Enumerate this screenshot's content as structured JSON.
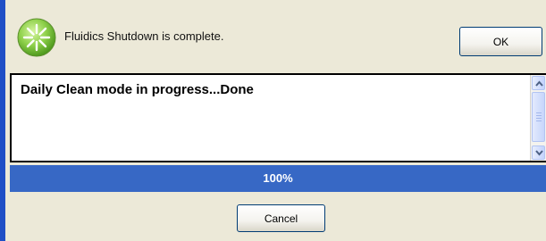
{
  "dialog": {
    "status_icon": "green-starburst-icon",
    "status_message": "Fluidics Shutdown is complete.",
    "ok_label": "OK"
  },
  "log": {
    "text": "Daily Clean mode in progress...Done"
  },
  "progress": {
    "value": 1.0,
    "label": "100%",
    "fill_color": "#3768c5"
  },
  "footer": {
    "cancel_label": "Cancel"
  },
  "colors": {
    "window_frame": "#1f4fc6",
    "dialog_background": "#ece9d8",
    "status_icon_green": "#7cc43a"
  }
}
